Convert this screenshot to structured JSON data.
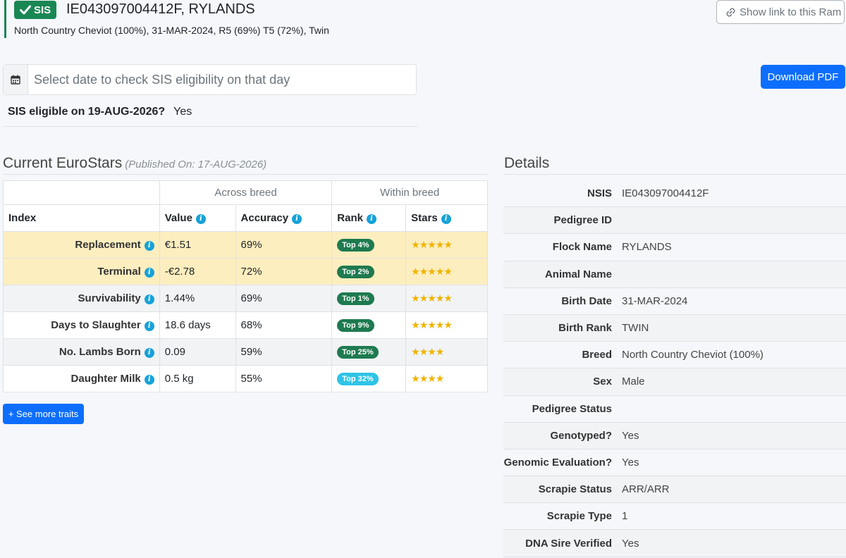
{
  "header": {
    "badge": "SIS",
    "title": "IE043097004412F, RYLANDS",
    "subtitle": "North Country Cheviot (100%), 31-MAR-2024, R5 (69%) T5 (72%), Twin",
    "link_button": "Show link to this Ram"
  },
  "eligibility": {
    "date_placeholder": "Select date to check SIS eligibility on that day",
    "question": "SIS eligible on 19-AUG-2026?",
    "answer": "Yes"
  },
  "download_pdf": "Download PDF",
  "eurostars": {
    "title": "Current EuroStars",
    "published": "(Published On: 17-AUG-2026)",
    "group_across": "Across breed",
    "group_within": "Within breed",
    "columns": [
      "Index",
      "Value",
      "Accuracy",
      "Rank",
      "Stars"
    ],
    "rows": [
      {
        "index": "Replacement",
        "value": "€1.51",
        "accuracy": "69%",
        "rank": "Top 4%",
        "stars": 5
      },
      {
        "index": "Terminal",
        "value": "-€2.78",
        "accuracy": "72%",
        "rank": "Top 2%",
        "stars": 5
      },
      {
        "index": "Survivability",
        "value": "1.44%",
        "accuracy": "69%",
        "rank": "Top 1%",
        "stars": 5
      },
      {
        "index": "Days to Slaughter",
        "value": "18.6 days",
        "accuracy": "68%",
        "rank": "Top 9%",
        "stars": 5
      },
      {
        "index": "No. Lambs Born",
        "value": "0.09",
        "accuracy": "59%",
        "rank": "Top 25%",
        "stars": 4
      },
      {
        "index": "Daughter Milk",
        "value": "0.5 kg",
        "accuracy": "55%",
        "rank": "Top 32%",
        "stars": 4
      }
    ],
    "see_more": "+ See more traits"
  },
  "details": {
    "title": "Details",
    "rows": [
      {
        "label": "NSIS",
        "value": "IE043097004412F"
      },
      {
        "label": "Pedigree ID",
        "value": ""
      },
      {
        "label": "Flock Name",
        "value": "RYLANDS"
      },
      {
        "label": "Animal Name",
        "value": ""
      },
      {
        "label": "Birth Date",
        "value": "31-MAR-2024"
      },
      {
        "label": "Birth Rank",
        "value": "TWIN"
      },
      {
        "label": "Breed",
        "value": "North Country Cheviot (100%)"
      },
      {
        "label": "Sex",
        "value": "Male"
      },
      {
        "label": "Pedigree Status",
        "value": ""
      },
      {
        "label": "Genotyped?",
        "value": "Yes"
      },
      {
        "label": "Genomic Evaluation?",
        "value": "Yes"
      },
      {
        "label": "Scrapie Status",
        "value": "ARR/ARR"
      },
      {
        "label": "Scrapie Type",
        "value": "1"
      },
      {
        "label": "DNA Sire Verified",
        "value": "Yes"
      }
    ]
  },
  "colors": {
    "success": "#198754",
    "primary": "#0d6efd",
    "highlight_row": "#fdeebf",
    "rank_badge": "#1e7a4f",
    "rank_badge_light": "#2ec4e6",
    "star": "#f0b400",
    "info": "#17a2d8"
  }
}
